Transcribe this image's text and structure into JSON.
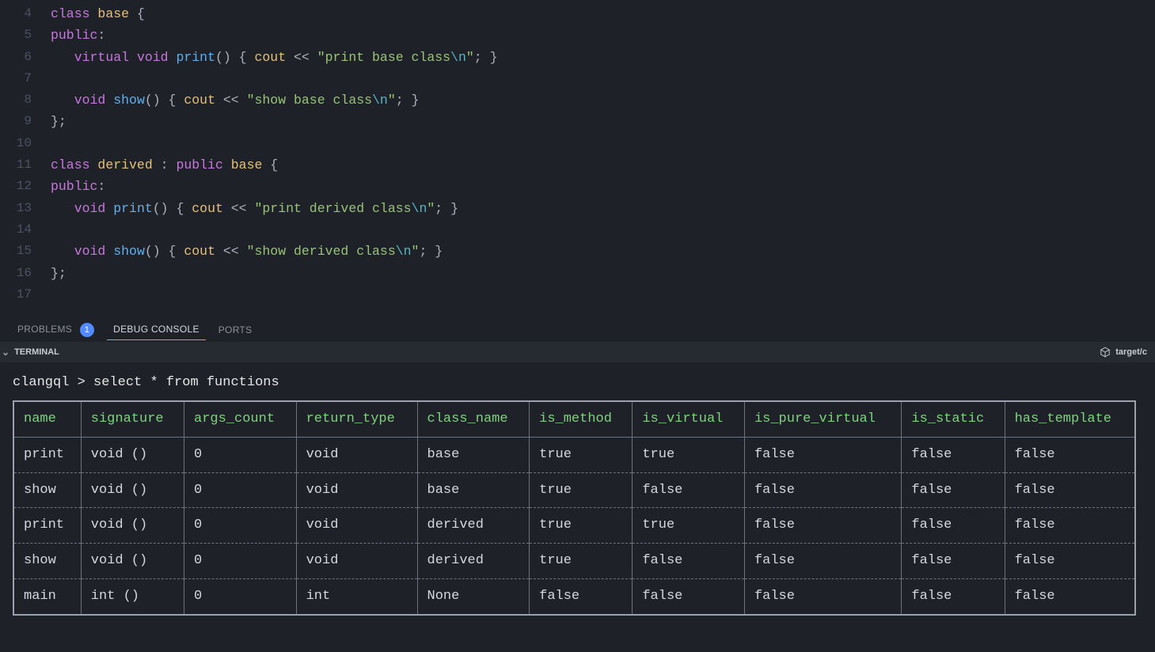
{
  "editor": {
    "first_line_no": 4,
    "lines": [
      {
        "raw": [
          [
            "k",
            "class"
          ],
          [
            "p",
            " "
          ],
          [
            "t",
            "base"
          ],
          [
            "p",
            " {"
          ]
        ]
      },
      {
        "raw": [
          [
            "pub",
            "public"
          ],
          [
            "p",
            ":"
          ]
        ]
      },
      {
        "raw": [
          [
            "p",
            "   "
          ],
          [
            "k",
            "virtual"
          ],
          [
            "p",
            " "
          ],
          [
            "k",
            "void"
          ],
          [
            "p",
            " "
          ],
          [
            "f",
            "print"
          ],
          [
            "p",
            "() { "
          ],
          [
            "t",
            "cout"
          ],
          [
            "p",
            " "
          ],
          [
            "p",
            "<<"
          ],
          [
            "p",
            " "
          ],
          [
            "s",
            "\"print base class"
          ],
          [
            "esc",
            "\\n"
          ],
          [
            "s",
            "\""
          ],
          [
            "p",
            "; }"
          ]
        ]
      },
      {
        "raw": [
          [
            "p",
            ""
          ]
        ]
      },
      {
        "raw": [
          [
            "p",
            "   "
          ],
          [
            "k",
            "void"
          ],
          [
            "p",
            " "
          ],
          [
            "f",
            "show"
          ],
          [
            "p",
            "() { "
          ],
          [
            "t",
            "cout"
          ],
          [
            "p",
            " "
          ],
          [
            "p",
            "<<"
          ],
          [
            "p",
            " "
          ],
          [
            "s",
            "\"show base class"
          ],
          [
            "esc",
            "\\n"
          ],
          [
            "s",
            "\""
          ],
          [
            "p",
            "; }"
          ]
        ]
      },
      {
        "raw": [
          [
            "p",
            "};"
          ]
        ]
      },
      {
        "raw": [
          [
            "p",
            ""
          ]
        ]
      },
      {
        "raw": [
          [
            "k",
            "class"
          ],
          [
            "p",
            " "
          ],
          [
            "t",
            "derived"
          ],
          [
            "p",
            " : "
          ],
          [
            "k",
            "public"
          ],
          [
            "p",
            " "
          ],
          [
            "t",
            "base"
          ],
          [
            "p",
            " {"
          ]
        ]
      },
      {
        "raw": [
          [
            "pub",
            "public"
          ],
          [
            "p",
            ":"
          ]
        ]
      },
      {
        "raw": [
          [
            "p",
            "   "
          ],
          [
            "k",
            "void"
          ],
          [
            "p",
            " "
          ],
          [
            "f",
            "print"
          ],
          [
            "p",
            "() { "
          ],
          [
            "t",
            "cout"
          ],
          [
            "p",
            " "
          ],
          [
            "p",
            "<<"
          ],
          [
            "p",
            " "
          ],
          [
            "s",
            "\"print derived class"
          ],
          [
            "esc",
            "\\n"
          ],
          [
            "s",
            "\""
          ],
          [
            "p",
            "; }"
          ]
        ]
      },
      {
        "raw": [
          [
            "p",
            ""
          ]
        ]
      },
      {
        "raw": [
          [
            "p",
            "   "
          ],
          [
            "k",
            "void"
          ],
          [
            "p",
            " "
          ],
          [
            "f",
            "show"
          ],
          [
            "p",
            "() { "
          ],
          [
            "t",
            "cout"
          ],
          [
            "p",
            " "
          ],
          [
            "p",
            "<<"
          ],
          [
            "p",
            " "
          ],
          [
            "s",
            "\"show derived class"
          ],
          [
            "esc",
            "\\n"
          ],
          [
            "s",
            "\""
          ],
          [
            "p",
            "; }"
          ]
        ]
      },
      {
        "raw": [
          [
            "p",
            "};"
          ]
        ]
      },
      {
        "raw": [
          [
            "p",
            ""
          ]
        ]
      }
    ]
  },
  "panel": {
    "tabs": {
      "problems": "PROBLEMS",
      "problems_count": "1",
      "debug_console": "DEBUG CONSOLE",
      "ports": "PORTS"
    }
  },
  "terminal_header": {
    "label": "TERMINAL",
    "right_label": "target/c"
  },
  "terminal": {
    "prompt_app": "clangql",
    "prompt_sep": ">",
    "prompt_cmd": "select * from functions",
    "columns": [
      "name",
      "signature",
      "args_count",
      "return_type",
      "class_name",
      "is_method",
      "is_virtual",
      "is_pure_virtual",
      "is_static",
      "has_template"
    ],
    "rows": [
      [
        "print",
        "void ()",
        "0",
        "void",
        "base",
        "true",
        "true",
        "false",
        "false",
        "false"
      ],
      [
        "show",
        "void ()",
        "0",
        "void",
        "base",
        "true",
        "false",
        "false",
        "false",
        "false"
      ],
      [
        "print",
        "void ()",
        "0",
        "void",
        "derived",
        "true",
        "true",
        "false",
        "false",
        "false"
      ],
      [
        "show",
        "void ()",
        "0",
        "void",
        "derived",
        "true",
        "false",
        "false",
        "false",
        "false"
      ],
      [
        "main",
        "int ()",
        "0",
        "int",
        "None",
        "false",
        "false",
        "false",
        "false",
        "false"
      ]
    ]
  }
}
